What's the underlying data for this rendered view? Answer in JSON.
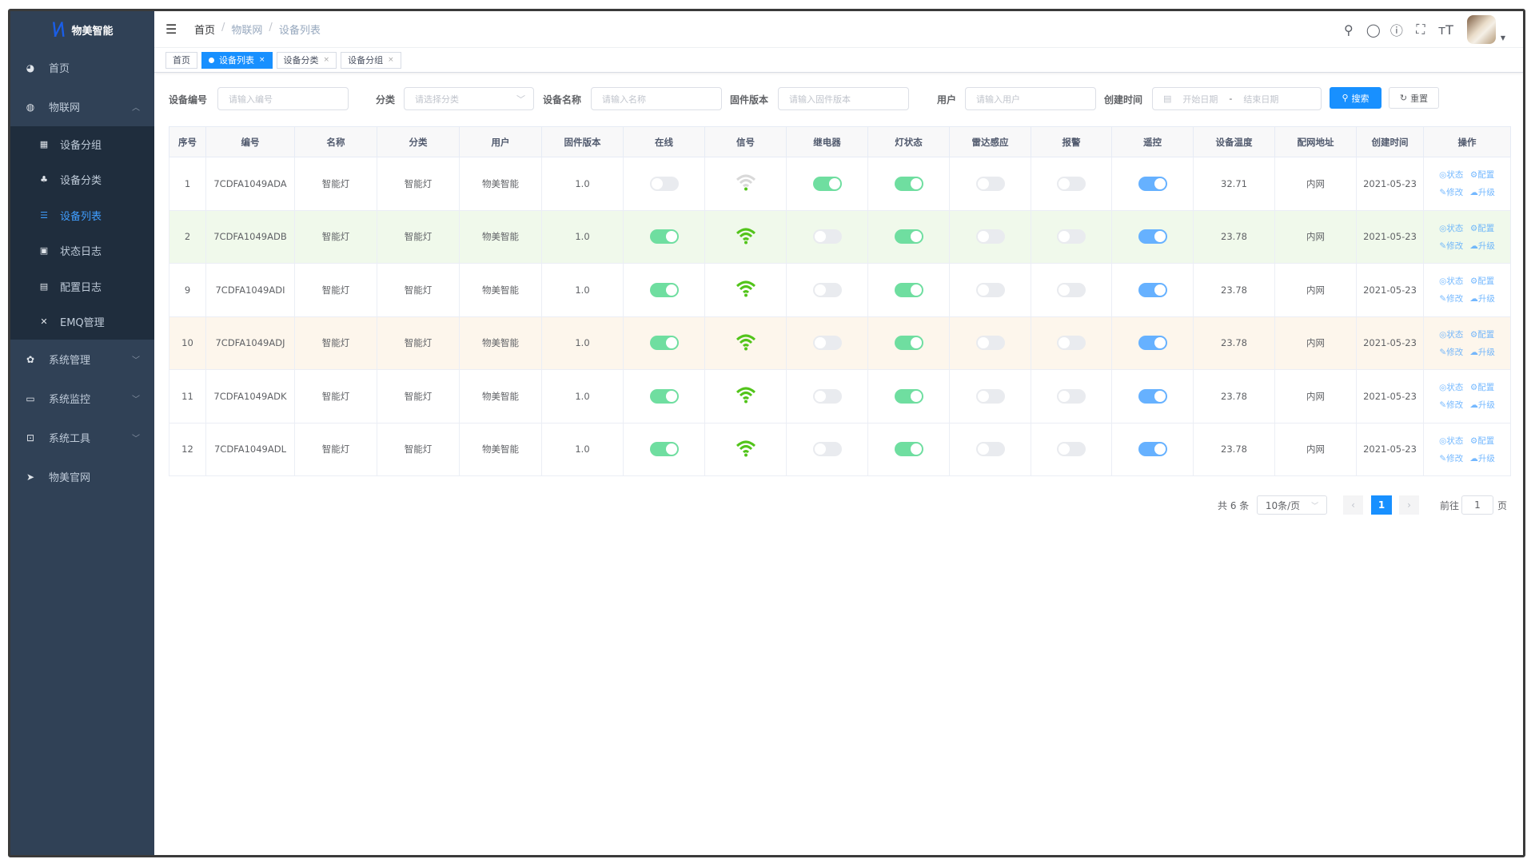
{
  "brand": {
    "name": "物美智能",
    "logo_text": "W"
  },
  "sidebar": {
    "items": [
      {
        "label": "首页",
        "icon": "dashboard-icon"
      },
      {
        "label": "物联网",
        "icon": "iot-icon",
        "expanded": true,
        "children": [
          {
            "label": "设备分组",
            "icon": "grid-icon"
          },
          {
            "label": "设备分类",
            "icon": "tree-icon"
          },
          {
            "label": "设备列表",
            "icon": "list-icon",
            "active": true
          },
          {
            "label": "状态日志",
            "icon": "log-icon"
          },
          {
            "label": "配置日志",
            "icon": "form-icon"
          },
          {
            "label": "EMQ管理",
            "icon": "cluster-icon"
          }
        ]
      },
      {
        "label": "系统管理",
        "icon": "gear-icon"
      },
      {
        "label": "系统监控",
        "icon": "monitor-icon"
      },
      {
        "label": "系统工具",
        "icon": "toolbox-icon"
      },
      {
        "label": "物美官网",
        "icon": "send-icon"
      }
    ]
  },
  "breadcrumb": [
    "首页",
    "物联网",
    "设备列表"
  ],
  "tabs": [
    {
      "label": "首页"
    },
    {
      "label": "设备列表",
      "active": true
    },
    {
      "label": "设备分类"
    },
    {
      "label": "设备分组"
    }
  ],
  "filters": {
    "code": {
      "label": "设备编号",
      "placeholder": "请输入编号"
    },
    "category": {
      "label": "分类",
      "placeholder": "请选择分类"
    },
    "name": {
      "label": "设备名称",
      "placeholder": "请输入名称"
    },
    "firmware": {
      "label": "固件版本",
      "placeholder": "请输入固件版本"
    },
    "user": {
      "label": "用户",
      "placeholder": "请输入用户"
    },
    "created": {
      "label": "创建时间",
      "start": "开始日期",
      "sep": "-",
      "end": "结束日期"
    },
    "search": "搜索",
    "reset": "重置"
  },
  "table": {
    "columns": [
      "序号",
      "编号",
      "名称",
      "分类",
      "用户",
      "固件版本",
      "在线",
      "信号",
      "继电器",
      "灯状态",
      "雷达感应",
      "报警",
      "遥控",
      "设备温度",
      "配网地址",
      "创建时间",
      "操作"
    ],
    "actions": [
      "状态",
      "配置",
      "修改",
      "升级"
    ],
    "rows": [
      {
        "id": "1",
        "code": "7CDFA1049ADA",
        "name": "智能灯",
        "category": "智能灯",
        "user": "物美智能",
        "firmware": "1.0",
        "online": false,
        "signal": "weak",
        "relay": true,
        "light": true,
        "radar": false,
        "alarm": false,
        "remote": true,
        "temp": "32.71",
        "network": "内网",
        "created": "2021-05-23",
        "highlight": ""
      },
      {
        "id": "2",
        "code": "7CDFA1049ADB",
        "name": "智能灯",
        "category": "智能灯",
        "user": "物美智能",
        "firmware": "1.0",
        "online": true,
        "signal": "strong",
        "relay": false,
        "light": true,
        "radar": false,
        "alarm": false,
        "remote": true,
        "temp": "23.78",
        "network": "内网",
        "created": "2021-05-23",
        "highlight": "green"
      },
      {
        "id": "9",
        "code": "7CDFA1049ADI",
        "name": "智能灯",
        "category": "智能灯",
        "user": "物美智能",
        "firmware": "1.0",
        "online": true,
        "signal": "strong",
        "relay": false,
        "light": true,
        "radar": false,
        "alarm": false,
        "remote": true,
        "temp": "23.78",
        "network": "内网",
        "created": "2021-05-23",
        "highlight": ""
      },
      {
        "id": "10",
        "code": "7CDFA1049ADJ",
        "name": "智能灯",
        "category": "智能灯",
        "user": "物美智能",
        "firmware": "1.0",
        "online": true,
        "signal": "strong",
        "relay": false,
        "light": true,
        "radar": false,
        "alarm": false,
        "remote": true,
        "temp": "23.78",
        "network": "内网",
        "created": "2021-05-23",
        "highlight": "warn"
      },
      {
        "id": "11",
        "code": "7CDFA1049ADK",
        "name": "智能灯",
        "category": "智能灯",
        "user": "物美智能",
        "firmware": "1.0",
        "online": true,
        "signal": "strong",
        "relay": false,
        "light": true,
        "radar": false,
        "alarm": false,
        "remote": true,
        "temp": "23.78",
        "network": "内网",
        "created": "2021-05-23",
        "highlight": ""
      },
      {
        "id": "12",
        "code": "7CDFA1049ADL",
        "name": "智能灯",
        "category": "智能灯",
        "user": "物美智能",
        "firmware": "1.0",
        "online": true,
        "signal": "strong",
        "relay": false,
        "light": true,
        "radar": false,
        "alarm": false,
        "remote": true,
        "temp": "23.78",
        "network": "内网",
        "created": "2021-05-23",
        "highlight": ""
      }
    ]
  },
  "pagination": {
    "total": "共 6 条",
    "page_size": "10条/页",
    "current": "1",
    "goto_label": "前往",
    "goto_value": "1",
    "page_suffix": "页"
  },
  "colors": {
    "primary": "#1890ff",
    "switch_green": "#6fdea0",
    "switch_blue": "#66b1ff",
    "signal_green": "#52c41a",
    "sidebar_bg": "#304156",
    "submenu_bg": "#1f2d3d"
  }
}
